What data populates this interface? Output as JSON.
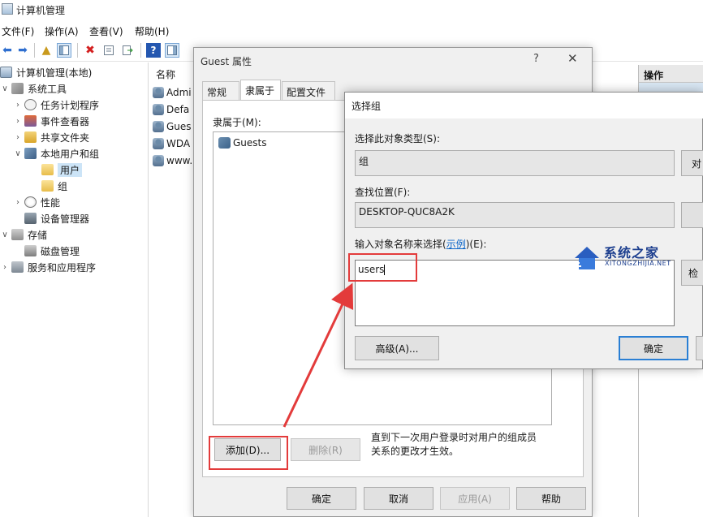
{
  "window": {
    "title": "计算机管理"
  },
  "menu": [
    "文件(F)",
    "操作(A)",
    "查看(V)",
    "帮助(H)"
  ],
  "tree": [
    {
      "label": "计算机管理(本地)",
      "level": 0
    },
    {
      "label": "系统工具",
      "level": 1
    },
    {
      "label": "任务计划程序",
      "level": 2
    },
    {
      "label": "事件查看器",
      "level": 2
    },
    {
      "label": "共享文件夹",
      "level": 2
    },
    {
      "label": "本地用户和组",
      "level": 2
    },
    {
      "label": "用户",
      "level": 3
    },
    {
      "label": "组",
      "level": 3
    },
    {
      "label": "性能",
      "level": 2
    },
    {
      "label": "设备管理器",
      "level": 2
    },
    {
      "label": "存储",
      "level": 1
    },
    {
      "label": "磁盘管理",
      "level": 2
    },
    {
      "label": "服务和应用程序",
      "level": 1
    }
  ],
  "list": {
    "header": "名称",
    "rows": [
      "Admi",
      "Defa",
      "Gues",
      "WDA",
      "www."
    ]
  },
  "actions": {
    "header": "操作"
  },
  "guest_dialog": {
    "title": "Guest 属性",
    "help": "?",
    "close": "✕",
    "tabs": [
      "常规",
      "隶属于",
      "配置文件"
    ],
    "member_of_label": "隶属于(M):",
    "members": [
      "Guests"
    ],
    "add_button": "添加(D)...",
    "remove_button": "删除(R)",
    "note": "直到下一次用户登录时对用户的组成员关系的更改才生效。",
    "ok": "确定",
    "cancel": "取消",
    "apply": "应用(A)",
    "help_button": "帮助"
  },
  "select_dialog": {
    "title": "选择组",
    "object_type_label": "选择此对象类型(S):",
    "object_type_value": "组",
    "object_type_button": "对",
    "location_label": "查找位置(F):",
    "location_value": "DESKTOP-QUC8A2K",
    "names_label_prefix": "输入对象名称来选择(",
    "names_label_link": "示例",
    "names_label_suffix": ")(E):",
    "names_value": "users",
    "check_button": "检",
    "advanced_button": "高级(A)...",
    "ok_button": "确定"
  },
  "watermark": {
    "brand": "系统之家",
    "site": "XITONGZHIJIA.NET"
  },
  "colors": {
    "highlight": "#e33b3b",
    "selection": "#cce4f7",
    "link": "#0a64c8",
    "default_button_border": "#2a7fd4"
  }
}
